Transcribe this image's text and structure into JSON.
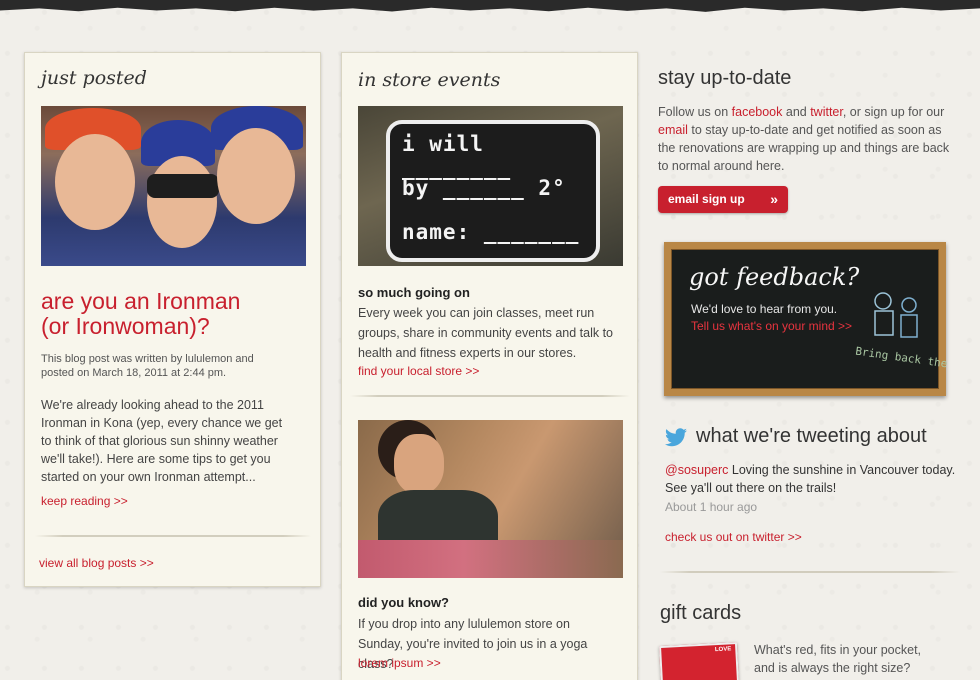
{
  "blog": {
    "heading": "just posted",
    "post_title_line1": "are you an Ironman",
    "post_title_line2": "(or Ironwoman)?",
    "meta": "This blog post was written by lululemon and posted on March 18, 2011 at 2:44 pm.",
    "excerpt": "We're already looking ahead to the 2011 Ironman in Kona (yep, every chance we get to think of that glorious sun shinny weather we'll take!). Here are some tips to get you started on your own Ironman attempt...",
    "keep_reading": "keep reading >>",
    "view_all": "view all blog posts >>"
  },
  "events": {
    "heading": "in store events",
    "board_line1": "i will ________",
    "board_line2": "by ______ 2°",
    "board_line3": "name: _______",
    "item1_title": "so much going on",
    "item1_body": "Every week you can join classes, meet run groups, share in community events and talk to health and fitness experts in our stores.",
    "item1_link": "find your local store >>",
    "item2_title": "did you know?",
    "item2_body": "If you drop into any lululemon store on Sunday, you're invited to join us in a yoga class?",
    "item2_link": "lorem ipsum >>"
  },
  "stay": {
    "heading": "stay up-to-date",
    "text_before_facebook": "Follow us on ",
    "facebook": "facebook",
    "text_and": " and ",
    "twitter": "twitter",
    "text_signup": ", or sign up for our ",
    "email": "email",
    "text_rest": " to stay up-to-date and get notified as soon as the renovations are wrapping up and things are back to normal around here.",
    "button": "email sign up",
    "button_arrow": "»"
  },
  "feedback": {
    "title": "got feedback?",
    "sub": "We'd love to hear from you.",
    "link": "Tell us what's on your mind >>",
    "doodle_text": "Bring back the"
  },
  "tweets": {
    "heading": "what we're tweeting about",
    "handle": "@sosuperc",
    "text": "  Loving the sunshine in Vancouver today. See ya'll out there on the trails!",
    "time": "About 1 hour ago",
    "link": "check us out on twitter >>"
  },
  "gift": {
    "heading": "gift cards",
    "text": "What's red, fits in your pocket, and is always the right size?",
    "card_label": "LOVE"
  }
}
